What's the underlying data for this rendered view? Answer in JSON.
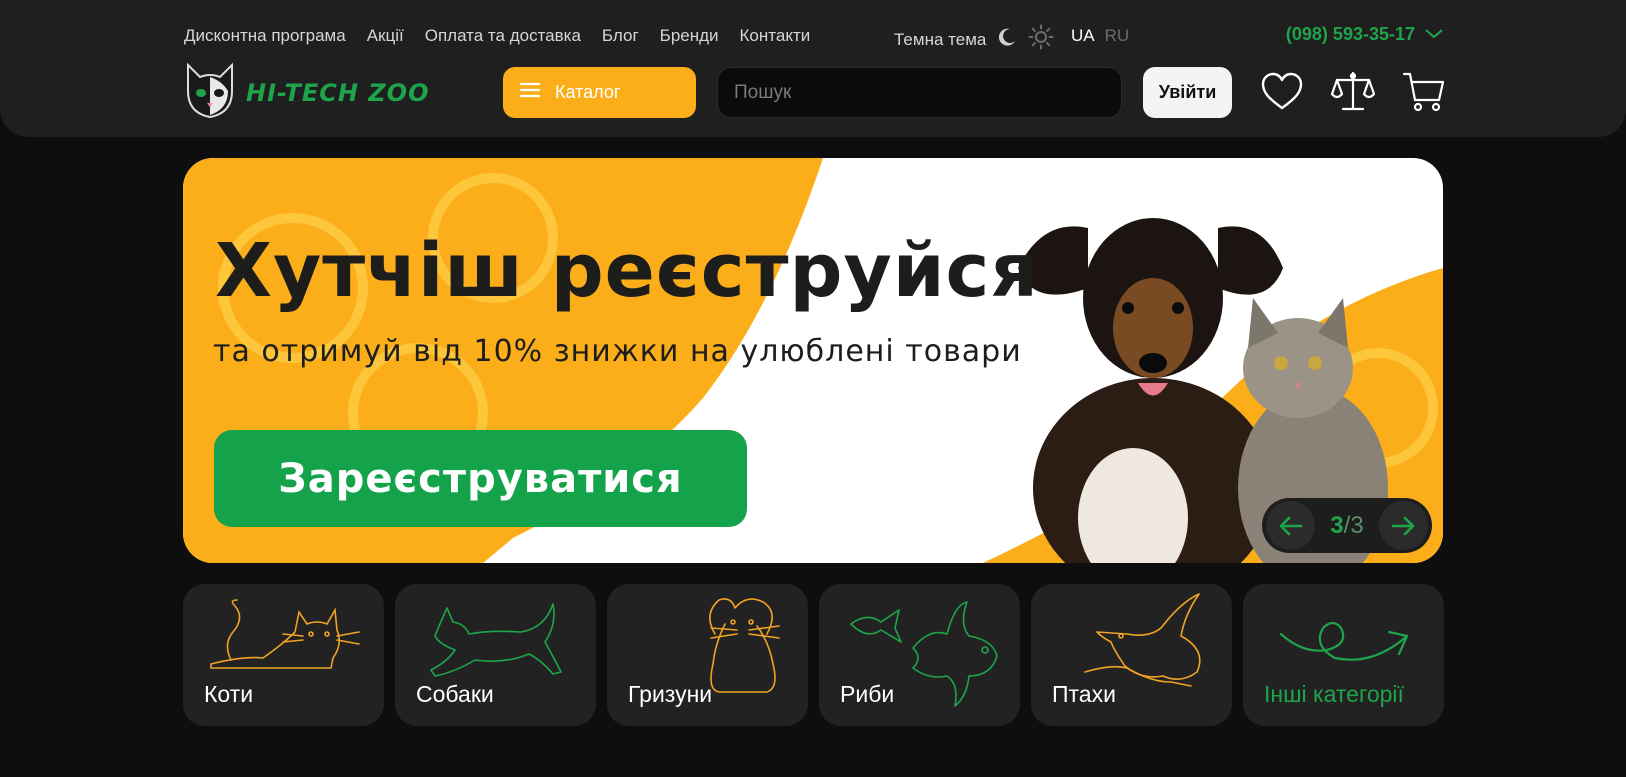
{
  "topnav": {
    "items": [
      "Дисконтна програма",
      "Акції",
      "Оплата та доставка",
      "Блог",
      "Бренди",
      "Контакти"
    ]
  },
  "theme": {
    "label": "Темна тема"
  },
  "lang": {
    "active": "UA",
    "inactive": "RU"
  },
  "phone": {
    "number": "(098) 593-35-17"
  },
  "logo": {
    "text": "HI-TECH ZOO"
  },
  "header": {
    "catalog_label": "Каталог",
    "search_placeholder": "Пошук",
    "login_label": "Увійти"
  },
  "banner": {
    "title": "Хутчіш реєструйся",
    "subtitle": "та отримуй від 10% знижки на улюблені товари",
    "cta": "Зареєструватися",
    "pager_current": "3",
    "pager_sep": "/",
    "pager_total": "3"
  },
  "categories": [
    {
      "label": "Коти"
    },
    {
      "label": "Собаки"
    },
    {
      "label": "Гризуни"
    },
    {
      "label": "Риби"
    },
    {
      "label": "Птахи"
    },
    {
      "label": "Інші категорії"
    }
  ],
  "colors": {
    "accent_green": "#1ea54b",
    "accent_orange": "#fbae1a",
    "background": "#0e0e0e",
    "panel": "#1f1f1f"
  }
}
